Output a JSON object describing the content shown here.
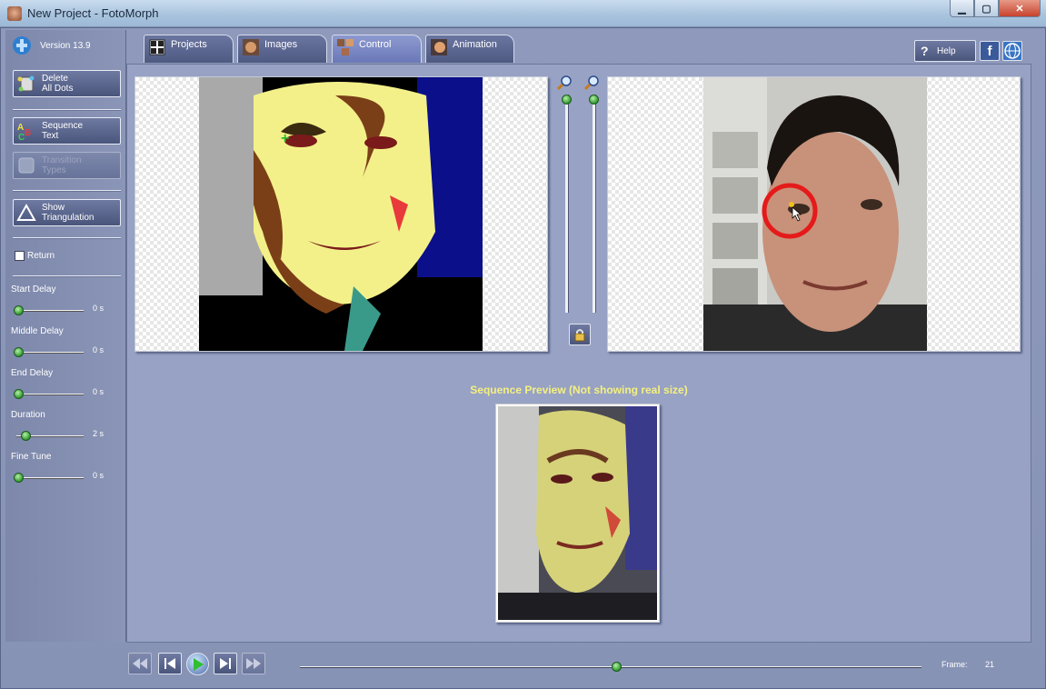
{
  "window": {
    "title": "New Project - FotoMorph",
    "controls": [
      "minimize",
      "maximize",
      "close"
    ]
  },
  "sidebar": {
    "version": "Version 13.9",
    "buttons": [
      {
        "line1": "Delete",
        "line2": "All Dots",
        "icon": "delete-dots-icon",
        "enabled": true
      },
      {
        "line1": "Sequence",
        "line2": "Text",
        "icon": "text-abc-icon",
        "enabled": true
      },
      {
        "line1": "Transition",
        "line2": "Types",
        "icon": "transition-types-icon",
        "enabled": false
      },
      {
        "line1": "Show",
        "line2": "Triangulation",
        "icon": "triangle-icon",
        "enabled": true
      }
    ],
    "return_checkbox": {
      "label": "Return",
      "checked": false
    },
    "sliders": [
      {
        "label": "Start Delay",
        "value": "0 s",
        "level": 0.0
      },
      {
        "label": "Middle Delay",
        "value": "0 s",
        "level": 0.0
      },
      {
        "label": "End Delay",
        "value": "0 s",
        "level": 0.0
      },
      {
        "label": "Duration",
        "value": "2 s",
        "level": 0.1
      },
      {
        "label": "Fine Tune",
        "value": "0 s",
        "level": 0.0
      }
    ]
  },
  "tabs": [
    {
      "label": "Projects",
      "icon": "grid-icon",
      "active": false
    },
    {
      "label": "Images",
      "icon": "face-thumbnail-icon",
      "active": false
    },
    {
      "label": "Control",
      "icon": "control-icon",
      "active": true
    },
    {
      "label": "Animation",
      "icon": "film-face-icon",
      "active": false
    }
  ],
  "header": {
    "help_label": "Help",
    "facebook_label": "f"
  },
  "main": {
    "preview_title": "Sequence Preview (Not showing real size)",
    "zoom_left_level": 0.0,
    "zoom_right_level": 0.0
  },
  "playback": {
    "buttons": [
      "first-frame",
      "previous-frame",
      "play",
      "next-frame",
      "last-frame"
    ],
    "frame_label": "Frame:",
    "frame_value": "21",
    "position": 0.51
  },
  "colors": {
    "accent_yellow": "#f4f080",
    "panel_blue": "#8d97b8",
    "slider_green": "#2f9a2f"
  }
}
